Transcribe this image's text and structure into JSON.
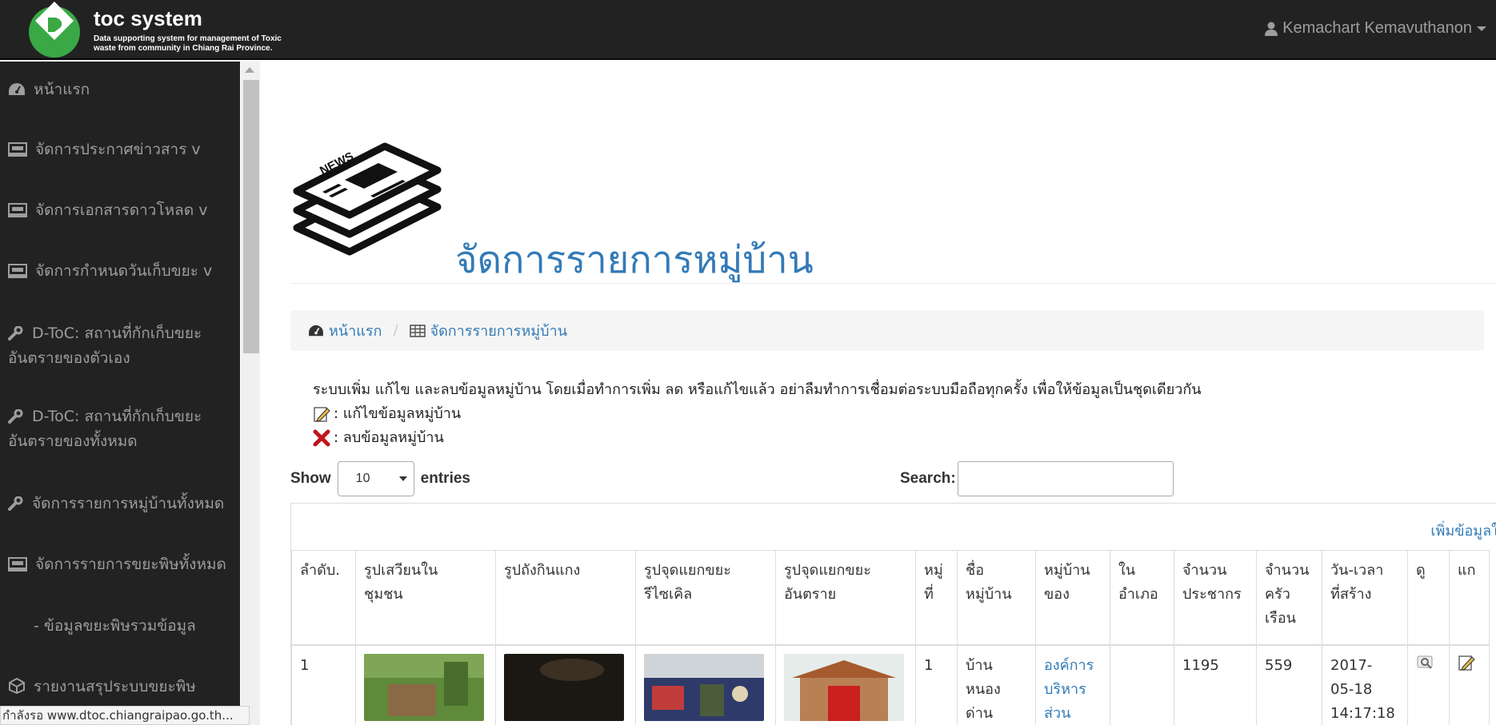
{
  "header": {
    "brand_title": "toc system",
    "brand_subtitle": "Data supporting system for management of Toxic waste from community in Chiang Rai Province.",
    "user_name": "Kemachart Kemavuthanon"
  },
  "sidebar": {
    "items": [
      {
        "label": "หน้าแรก",
        "icon": "dashboard-icon"
      },
      {
        "label": "จัดการประกาศข่าวสาร v",
        "icon": "seo-monitor-icon"
      },
      {
        "label": "จัดการเอกสารดาวโหลด v",
        "icon": "seo-monitor-icon"
      },
      {
        "label": "จัดการกำหนดวันเก็บขยะ v",
        "icon": "seo-monitor-icon"
      },
      {
        "label_line1": "D-ToC: สถานที่กักเก็บขยะ",
        "label_line2": "อันตรายของตัวเอง",
        "icon": "wrench-icon"
      },
      {
        "label_line1": "D-ToC: สถานที่กักเก็บขยะ",
        "label_line2": "อันตรายของทั้งหมด",
        "icon": "wrench-icon"
      },
      {
        "label": "จัดการรายการหมู่บ้านทั้งหมด",
        "icon": "wrench-icon"
      },
      {
        "label": "จัดการรายการขยะพิษทั้งหมด",
        "icon": "seo-monitor-icon"
      },
      {
        "label": "- ข้อมูลขยะพิษรวมข้อมูล",
        "icon": ""
      },
      {
        "label": "รายงานสรุประบบขยะพิษ",
        "icon": "boxes-icon"
      }
    ]
  },
  "status_bar": "กำลังรอ www.dtoc.chiangraipao.go.th...",
  "page": {
    "title": "จัดการรายการหมู่บ้าน",
    "breadcrumb": {
      "home": "หน้าแรก",
      "current": "จัดการรายการหมู่บ้าน"
    },
    "intro": "ระบบเพิ่ม แก้ไข และลบข้อมูลหมู่บ้าน โดยเมื่อทำการเพิ่ม ลด หรือแก้ไขแล้ว อย่าลืมทำการเชื่อมต่อระบบมือถือทุกครั้ง เพื่อให้ข้อมูลเป็นชุดเดียวกัน",
    "legend_edit": ": แก้ไขข้อมูลหมู่บ้าน",
    "legend_delete": ": ลบข้อมูลหมู่บ้าน"
  },
  "table_controls": {
    "show_label": "Show",
    "entries_value": "10",
    "entries_label": "entries",
    "search_label": "Search:",
    "add_link": "เพิ่มข้อมูลใ"
  },
  "table": {
    "headers": [
      {
        "l1": "ลำดับ.",
        "l2": "",
        "l3": ""
      },
      {
        "l1": "รูปเสวียนใน",
        "l2": "ชุมชน",
        "l3": ""
      },
      {
        "l1": "รูปถังกินแกง",
        "l2": "",
        "l3": ""
      },
      {
        "l1": "รูปจุดแยกขยะ",
        "l2": "รีไซเคิล",
        "l3": ""
      },
      {
        "l1": "รูปจุดแยกขยะ",
        "l2": "อันตราย",
        "l3": ""
      },
      {
        "l1": "หมู่",
        "l2": "ที่",
        "l3": ""
      },
      {
        "l1": "ชื่อ",
        "l2": "หมู่บ้าน",
        "l3": ""
      },
      {
        "l1": "หมู่บ้าน",
        "l2": "ของ",
        "l3": ""
      },
      {
        "l1": "ใน",
        "l2": "อำเภอ",
        "l3": ""
      },
      {
        "l1": "จำนวน",
        "l2": "ประชากร",
        "l3": ""
      },
      {
        "l1": "จำนวน",
        "l2": "ครัว",
        "l3": "เรือน"
      },
      {
        "l1": "วัน-เวลา",
        "l2": "ที่สร้าง",
        "l3": ""
      },
      {
        "l1": "ดู",
        "l2": "",
        "l3": ""
      },
      {
        "l1": "แก",
        "l2": "",
        "l3": ""
      }
    ],
    "rows": [
      {
        "no": "1",
        "moo": "1",
        "village_l1": "บ้าน",
        "village_l2": "หนอง",
        "village_l3": "ด่าน",
        "org_l1": "องค์การ",
        "org_l2": "บริหาร",
        "org_l3": "ส่วน",
        "amphoe": "",
        "population": "1195",
        "households": "559",
        "created_date": "2017-",
        "created_md": "05-18",
        "created_time": "14:17:18"
      }
    ]
  },
  "colors": {
    "navbar": "#222222",
    "link": "#337ab7",
    "sidebar_text": "#9d9d9d"
  }
}
